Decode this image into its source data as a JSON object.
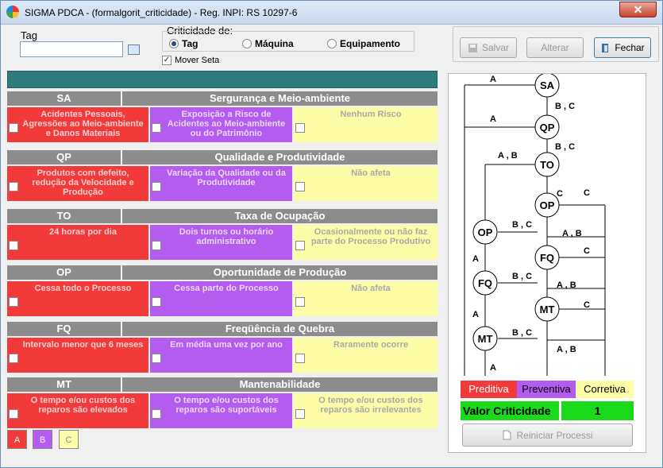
{
  "window": {
    "title": "SIGMA PDCA -   (formalgorit_criticidade)  - Reg. INPI: RS 10297-6",
    "close": "✕"
  },
  "tag": {
    "label": "Tag",
    "value": ""
  },
  "criticidade": {
    "label": "Criticidade de:",
    "options": [
      {
        "label": "Tag",
        "selected": true
      },
      {
        "label": "Máquina",
        "selected": false
      },
      {
        "label": "Equipamento",
        "selected": false
      }
    ]
  },
  "mover_seta": {
    "label": "Mover Seta",
    "checked": true
  },
  "toolbar": {
    "salvar": "Salvar",
    "alterar": "Alterar",
    "fechar": "Fechar"
  },
  "sections": [
    {
      "code": "SA",
      "title": "Sergurança e Meio-ambiente",
      "a": "Acidentes Pessoais, Agressões ao Meio-ambiente e Danos Materiais",
      "b": "Exposição a Risco de Acidentes ao Meio-ambiente ou do Patrimônio",
      "c": "Nenhum Risco"
    },
    {
      "code": "QP",
      "title": "Qualidade e Produtividade",
      "a": "Produtos com defeito, redução da Velocidade e Produção",
      "b": "Variação da Qualidade ou da Produtividade",
      "c": "Não afeta"
    },
    {
      "code": "TO",
      "title": "Taxa de Ocupação",
      "a": "24 horas por dia",
      "b": "Dois turnos ou horário administrativo",
      "c": "Ocasionalmente ou não faz parte do Processo Produtivo"
    },
    {
      "code": "OP",
      "title": "Oportunidade de Produção",
      "a": "Cessa todo o Processo",
      "b": "Cessa parte do Processo",
      "c": "Não afeta"
    },
    {
      "code": "FQ",
      "title": "Freqüência de Quebra",
      "a": "Intervalo menor que 6 meses",
      "b": "Em média uma vez por ano",
      "c": "Raramente ocorre"
    },
    {
      "code": "MT",
      "title": "Mantenabilidade",
      "a": "O tempo e/ou custos dos reparos são elevados",
      "b": "O tempo e/ou custos dos reparos são suportáveis",
      "c": "O tempo e/ou custos dos reparos são irrelevantes"
    }
  ],
  "legend": {
    "a": "A",
    "b": "B",
    "c": "C"
  },
  "flow": {
    "nodes": [
      "SA",
      "QP",
      "TO",
      "OP",
      "OP",
      "FQ",
      "FQ",
      "MT",
      "MT"
    ],
    "edge_labels": [
      "A",
      "B , C",
      "A",
      "B , C",
      "A , B",
      "C",
      "C",
      "B , C",
      "A , B",
      "A",
      "C",
      "B , C",
      "A , B",
      "A",
      "C",
      "B , C",
      "A , B",
      "A"
    ]
  },
  "result": {
    "preditiva": "Preditiva",
    "preventiva": "Preventiva",
    "corretiva": "Corretiva",
    "valor_label": "Valor Criticidade",
    "valor": "1",
    "reiniciar": "Reiniciar Processi"
  },
  "colors": {
    "red": "#f33a3a",
    "purple": "#b45cf0",
    "yellow": "#fdfda8",
    "green": "#1bd91b",
    "teal": "#2e7b7b",
    "header": "#8c8c8c"
  }
}
